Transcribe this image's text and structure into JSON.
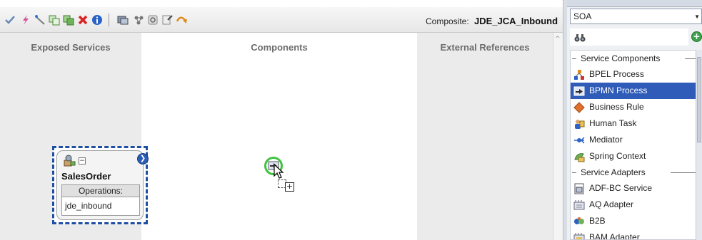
{
  "editor": {
    "toolbar": {
      "icons": [
        "validate-icon",
        "lightning-icon",
        "wire-icon",
        "copy-icon",
        "paste-icon",
        "delete-icon",
        "info-icon",
        "layout-icon",
        "deploy-icon",
        "refresh-icon",
        "test-icon",
        "trace-icon"
      ],
      "composite_label": "Composite:",
      "composite_name": "JDE_JCA_Inbound"
    },
    "lanes": {
      "exposed": "Exposed Services",
      "components": "Components",
      "external": "External References"
    },
    "service": {
      "name": "SalesOrder",
      "operations_header": "Operations:",
      "operations": [
        "jde_inbound"
      ]
    }
  },
  "palette": {
    "selected_category": "SOA",
    "search_value": "",
    "groups": [
      {
        "title": "Service Components",
        "items": [
          {
            "label": "BPEL Process",
            "icon": "bpel-process-icon",
            "selected": false
          },
          {
            "label": "BPMN Process",
            "icon": "bpmn-process-icon",
            "selected": true
          },
          {
            "label": "Business Rule",
            "icon": "business-rule-icon",
            "selected": false
          },
          {
            "label": "Human Task",
            "icon": "human-task-icon",
            "selected": false
          },
          {
            "label": "Mediator",
            "icon": "mediator-icon",
            "selected": false
          },
          {
            "label": "Spring Context",
            "icon": "spring-context-icon",
            "selected": false
          }
        ]
      },
      {
        "title": "Service Adapters",
        "items": [
          {
            "label": "ADF-BC Service",
            "icon": "adf-bc-service-icon",
            "selected": false
          },
          {
            "label": "AQ Adapter",
            "icon": "aq-adapter-icon",
            "selected": false
          },
          {
            "label": "B2B",
            "icon": "b2b-icon",
            "selected": false
          },
          {
            "label": "BAM Adapter",
            "icon": "bam-adapter-icon",
            "selected": false
          }
        ]
      }
    ],
    "colors": {
      "selection": "#2f5cb8",
      "lane": "#ebebeb",
      "card_border": "#1e4fa3",
      "drag_ring": "#3fc33f"
    }
  }
}
